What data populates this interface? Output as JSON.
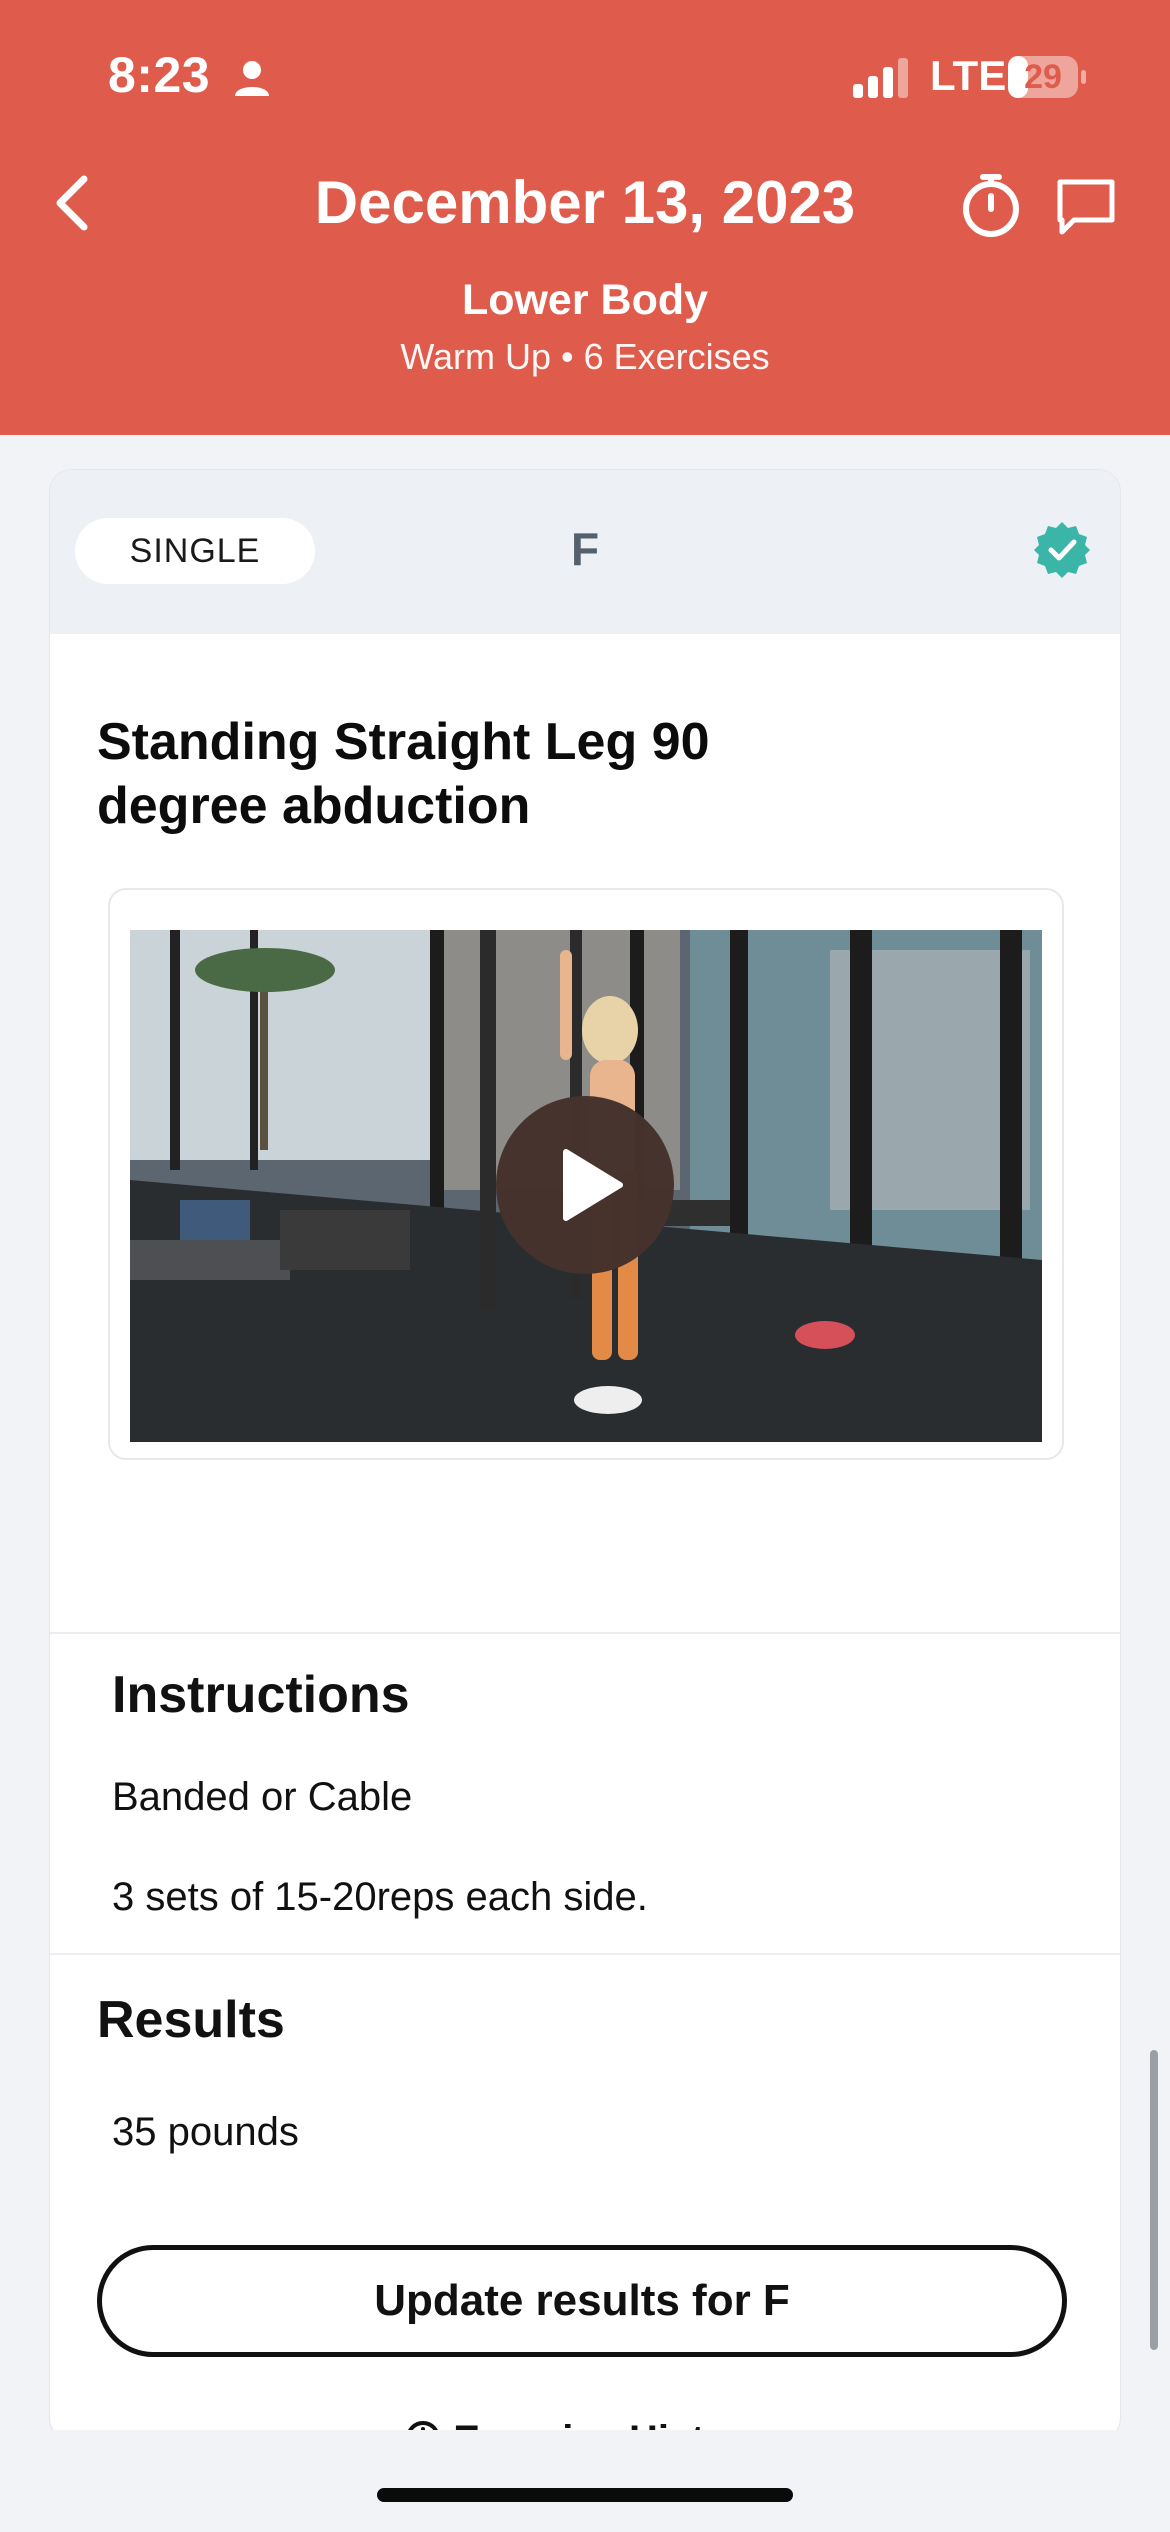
{
  "status_bar": {
    "time": "8:23",
    "network": "LTE",
    "battery_level": "29",
    "battery_fraction": 0.29
  },
  "header": {
    "title": "December 13, 2023",
    "workout_name": "Lower Body",
    "meta": "Warm Up • 6 Exercises",
    "color": "#df5b4b",
    "icons": [
      "back-chevron-icon",
      "stopwatch-icon",
      "chat-bubble-icon"
    ]
  },
  "card": {
    "type_pill": "SINGLE",
    "athlete_initial": "F",
    "completed_color": "#3ab5a7",
    "exercise_title": "Standing Straight Leg 90 degree abduction"
  },
  "instructions": {
    "title": "Instructions",
    "lines": [
      "Banded or Cable",
      "3 sets of 15-20reps each side."
    ]
  },
  "results": {
    "title": "Results",
    "value": "35 pounds",
    "update_button": "Update results for F",
    "history_link": "Exercise History"
  }
}
